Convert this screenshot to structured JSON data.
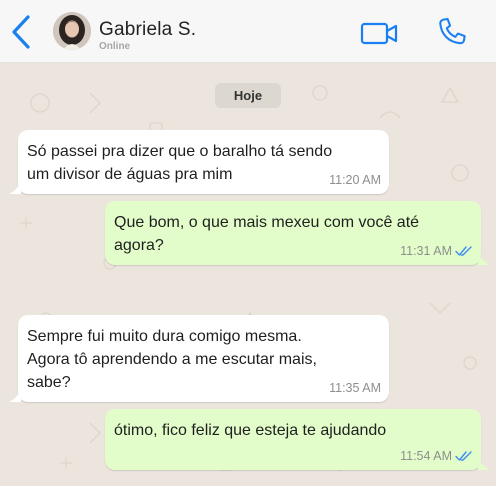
{
  "header": {
    "contact_name": "Gabriela S.",
    "status": "Online"
  },
  "chat": {
    "date_chip": "Hoje",
    "messages": [
      {
        "direction": "incoming",
        "text": "Só passei pra dizer que o baralho tá sendo\num divisor de águas pra mim",
        "time": "11:20 AM"
      },
      {
        "direction": "outgoing",
        "text": "Que bom, o que mais mexeu com você até\nagora?",
        "time": "11:31 AM",
        "read": true
      },
      {
        "direction": "incoming",
        "text": "Sempre fui muito dura comigo mesma.\nAgora tô aprendendo a me escutar mais,\nsabe?",
        "time": "11:35 AM"
      },
      {
        "direction": "outgoing",
        "text": "ótimo, fico feliz que esteja te ajudando",
        "time": "11:54 AM",
        "read": true
      }
    ]
  },
  "colors": {
    "accent": "#1a7ff0",
    "outgoing_bubble": "#e2fdc9",
    "incoming_bubble": "#ffffff",
    "chat_background": "#ebe5de",
    "read_ticks": "#3d8ef0"
  },
  "icons": {
    "back": "chevron-left-icon",
    "video": "video-camera-icon",
    "call": "phone-icon",
    "read": "double-check-icon"
  }
}
